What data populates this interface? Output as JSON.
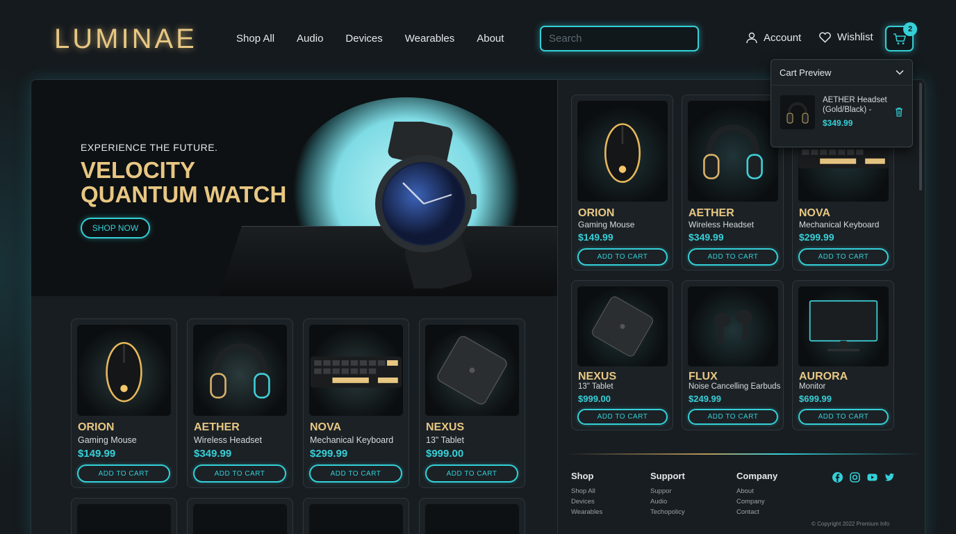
{
  "brand": {
    "logo": "LUMINAE",
    "accent": "#35d0d8",
    "gold": "#e8c783"
  },
  "nav": {
    "items": [
      "Shop All",
      "Audio",
      "Devices",
      "Wearables",
      "About"
    ]
  },
  "search": {
    "placeholder": "Search",
    "value": ""
  },
  "header": {
    "account_label": "Account",
    "wishlist_label": "Wishlist",
    "cart_count": "2"
  },
  "hero": {
    "eyebrow": "EXPERIENCE THE FUTURE.",
    "title_line1": "VELOCITY",
    "title_line2": "QUANTUM WATCH",
    "cta": "SHOP NOW"
  },
  "cart_preview": {
    "title": "Cart Preview",
    "item_name": "AETHER Headset (Gold/Black) -",
    "item_price": "$349.99"
  },
  "left_grid": [
    {
      "name": "ORION",
      "sub": "Gaming Mouse",
      "price": "$149.99",
      "cta": "ADD TO CART",
      "icon": "mouse"
    },
    {
      "name": "AETHER",
      "sub": "Wireless Headset",
      "price": "$349.99",
      "cta": "ADD TO CART",
      "icon": "headset"
    },
    {
      "name": "NOVA",
      "sub": "Mechanical Keyboard",
      "price": "$299.99",
      "cta": "ADD TO CART",
      "icon": "keyboard"
    },
    {
      "name": "NEXUS",
      "sub": "13\" Tablet",
      "price": "$999.00",
      "cta": "ADD TO CART",
      "icon": "tablet"
    }
  ],
  "right_grid": [
    {
      "name": "ORION",
      "sub": "Gaming Mouse",
      "price": "$149.99",
      "cta": "ADD TO CART",
      "icon": "mouse"
    },
    {
      "name": "AETHER",
      "sub": "Wireless Headset",
      "price": "$349.99",
      "cta": "ADD TO CART",
      "icon": "headset"
    },
    {
      "name": "NOVA",
      "sub": "Mechanical Keyboard",
      "price": "$299.99",
      "cta": "ADD TO CART",
      "icon": "keyboard"
    },
    {
      "name": "NEXUS",
      "sub": "13\" Tablet",
      "price": "$999.00",
      "cta": "ADD TO CART",
      "icon": "tablet"
    },
    {
      "name": "FLUX",
      "sub": "Noise Cancelling Earbuds",
      "price": "$249.99",
      "cta": "ADD TO CART",
      "icon": "earbuds"
    },
    {
      "name": "AURORA",
      "sub": "Monitor",
      "price": "$699.99",
      "cta": "ADD TO CART",
      "icon": "monitor"
    }
  ],
  "footer": {
    "shop": {
      "title": "Shop",
      "links": [
        "Shop All",
        "Devices",
        "Wearables"
      ]
    },
    "support": {
      "title": "Support",
      "links": [
        "Suppor",
        "Audio",
        "Techopolicy"
      ]
    },
    "company": {
      "title": "Company",
      "links": [
        "About",
        "Company",
        "Contact"
      ]
    },
    "copyright": "© Copyright 2022 Premium Info",
    "social_icons": [
      "facebook-icon",
      "instagram-icon",
      "youtube-icon",
      "twitter-icon"
    ]
  }
}
